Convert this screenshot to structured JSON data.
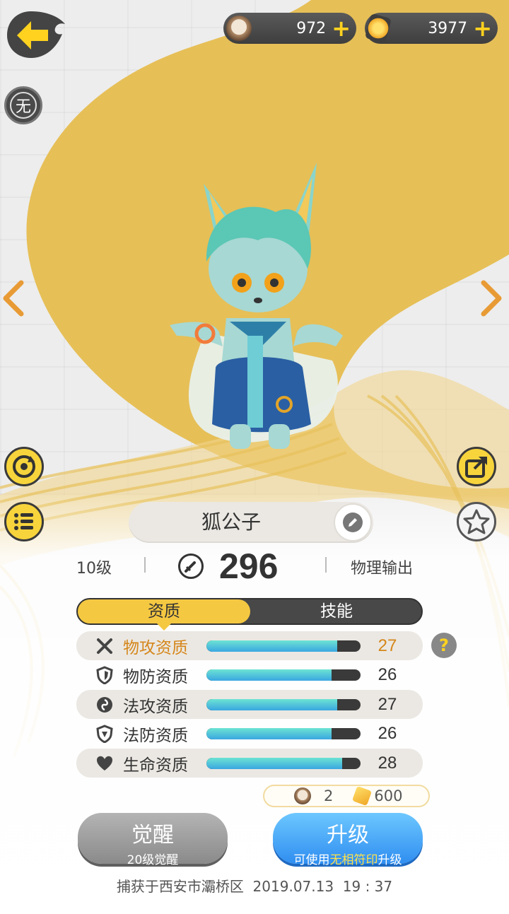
{
  "header": {
    "back_icon": "arrow-left-icon",
    "badge": "无",
    "currencies": [
      {
        "icon": "coin-face-icon",
        "value": "972",
        "plus": "+"
      },
      {
        "icon": "crystal-icon",
        "value": "3977",
        "plus": "+"
      }
    ]
  },
  "monster": {
    "name": "狐公子",
    "level": "10级",
    "power": "296",
    "role": "物理输出"
  },
  "tabs": {
    "active": "资质",
    "inactive": "技能"
  },
  "attributes": [
    {
      "label": "物攻资质",
      "value": "27",
      "fill": 0.85,
      "icon": "swords-icon",
      "highlight": true
    },
    {
      "label": "物防资质",
      "value": "26",
      "fill": 0.81,
      "icon": "shield-icon",
      "highlight": false
    },
    {
      "label": "法攻资质",
      "value": "27",
      "fill": 0.85,
      "icon": "magic-orb-icon",
      "highlight": false
    },
    {
      "label": "法防资质",
      "value": "26",
      "fill": 0.81,
      "icon": "magic-shield-icon",
      "highlight": false
    },
    {
      "label": "生命资质",
      "value": "28",
      "fill": 0.88,
      "icon": "heart-icon",
      "highlight": false
    }
  ],
  "help": "?",
  "cost": {
    "coin": "2",
    "crystal": "600"
  },
  "buttons": {
    "awaken_label": "觉醒",
    "awaken_sub": "20级觉醒",
    "upgrade_label": "升级",
    "upgrade_sub_pre": "可使用",
    "upgrade_sub_hl": "无相符印",
    "upgrade_sub_post": "升级"
  },
  "footer": "捕获于西安市灞桥区  2019.07.13  19 : 37",
  "colors": {
    "accent_gold": "#f5c842",
    "bar_fill": "#3aa7e0",
    "highlight_text": "#d5861a",
    "upgrade_blue": "#2f8ef0"
  }
}
